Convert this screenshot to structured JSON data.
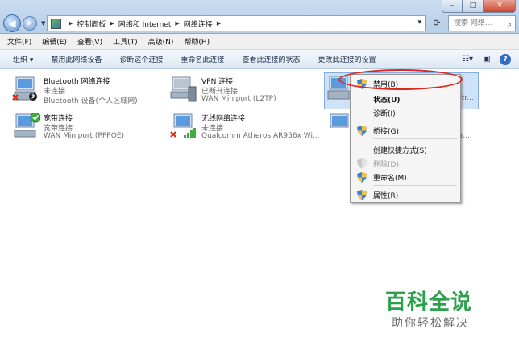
{
  "window": {
    "min": "–",
    "max": "□",
    "close": "✕"
  },
  "address": {
    "crumbs": [
      "控制面板",
      "网络和 Internet",
      "网络连接"
    ],
    "search_placeholder": "搜索 网络..."
  },
  "menu": [
    "文件(F)",
    "编辑(E)",
    "查看(V)",
    "工具(T)",
    "高级(N)",
    "帮助(H)"
  ],
  "commands": [
    "组织 ▾",
    "禁用此网络设备",
    "诊断这个连接",
    "重命名此连接",
    "查看此连接的状态",
    "更改此连接的设置"
  ],
  "connections": [
    {
      "name": "Bluetooth 网络连接",
      "status": "未连接",
      "device": "Bluetooth 设备(个人区域网)"
    },
    {
      "name": "VPN 连接",
      "status": "已断开连接",
      "device": "WAN Miniport (L2TP)"
    },
    {
      "name": "",
      "status": "",
      "device": "ntr..."
    },
    {
      "name": "宽带连接",
      "status": "宽带连接",
      "device": "WAN Miniport (PPPOE)"
    },
    {
      "name": "无线网络连接",
      "status": "未连接",
      "device": "Qualcomm Atheros AR956x Wi..."
    },
    {
      "name": "",
      "status": "",
      "device": "or..."
    }
  ],
  "context_menu": {
    "disable": "禁用(B)",
    "status": "状态(U)",
    "diagnose": "诊断(I)",
    "bridge": "桥接(G)",
    "shortcut": "创建快捷方式(S)",
    "delete": "删除(D)",
    "rename": "重命名(M)",
    "properties": "属性(R)"
  },
  "watermark": {
    "title": "百科全说",
    "subtitle": "助你轻松解决"
  },
  "colors": {
    "accent_red": "#d9291f",
    "watermark_green": "#2aa14a",
    "selection": "#cfe3f8"
  }
}
